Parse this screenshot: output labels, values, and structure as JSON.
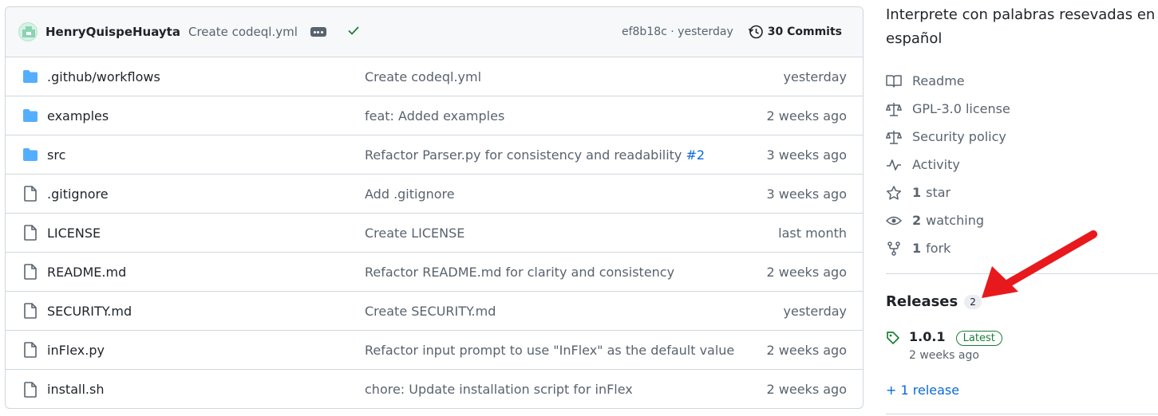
{
  "commit": {
    "author": "HenryQuispeHuayta",
    "message": "Create codeql.yml",
    "sha_time": "ef8b18c · yesterday",
    "commits_label": "30 Commits"
  },
  "files": [
    {
      "name": ".github/workflows",
      "type": "folder",
      "message": "Create codeql.yml",
      "link": "",
      "date": "yesterday"
    },
    {
      "name": "examples",
      "type": "folder",
      "message": "feat: Added examples",
      "link": "",
      "date": "2 weeks ago"
    },
    {
      "name": "src",
      "type": "folder",
      "message": "Refactor Parser.py for consistency and readability ",
      "link": "#2",
      "date": "3 weeks ago"
    },
    {
      "name": ".gitignore",
      "type": "file",
      "message": "Add .gitignore",
      "link": "",
      "date": "3 weeks ago"
    },
    {
      "name": "LICENSE",
      "type": "file",
      "message": "Create LICENSE",
      "link": "",
      "date": "last month"
    },
    {
      "name": "README.md",
      "type": "file",
      "message": "Refactor README.md for clarity and consistency",
      "link": "",
      "date": "2 weeks ago"
    },
    {
      "name": "SECURITY.md",
      "type": "file",
      "message": "Create SECURITY.md",
      "link": "",
      "date": "yesterday"
    },
    {
      "name": "inFlex.py",
      "type": "file",
      "message": "Refactor input prompt to use \"InFlex\" as the default value",
      "link": "",
      "date": "2 weeks ago"
    },
    {
      "name": "install.sh",
      "type": "file",
      "message": "chore: Update installation script for inFlex",
      "link": "",
      "date": "2 weeks ago"
    }
  ],
  "about": {
    "description": "Interprete con palabras resevadas en español",
    "links": [
      {
        "icon": "book-icon",
        "count": "",
        "label": "Readme"
      },
      {
        "icon": "scale-icon",
        "count": "",
        "label": "GPL-3.0 license"
      },
      {
        "icon": "scale-icon",
        "count": "",
        "label": "Security policy"
      },
      {
        "icon": "pulse-icon",
        "count": "",
        "label": "Activity"
      },
      {
        "icon": "star-icon",
        "count": "1",
        "label": "star"
      },
      {
        "icon": "eye-icon",
        "count": "2",
        "label": "watching"
      },
      {
        "icon": "fork-icon",
        "count": "1",
        "label": "fork"
      }
    ]
  },
  "releases": {
    "title": "Releases",
    "count": "2",
    "latest_version": "1.0.1",
    "latest_badge": "Latest",
    "latest_date": "2 weeks ago",
    "more_link": "+ 1 release"
  },
  "colors": {
    "folder": "#54aeff",
    "link": "#0969da",
    "success": "#1a7f37",
    "annotation_arrow": "#e8191c"
  }
}
